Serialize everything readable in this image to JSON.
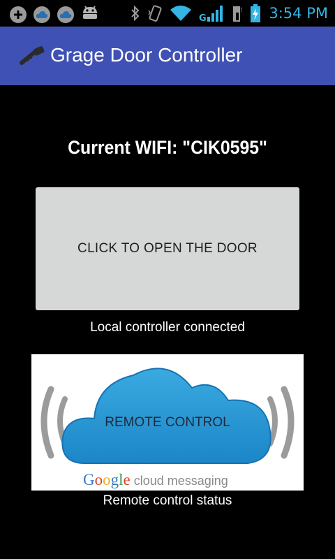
{
  "status_bar": {
    "time": "3:54 PM",
    "network_label": "G",
    "colors": {
      "accent": "#33b5e5",
      "icon_gray": "#9a9a9a"
    }
  },
  "app_bar": {
    "title": "Grage Door Controller",
    "background": "#3f51b5"
  },
  "main": {
    "wifi_text": "Current WIFI: \"CIK0595\"",
    "open_button_label": "CLICK TO OPEN THE DOOR",
    "local_status": "Local controller connected",
    "remote_button_label": "REMOTE CONTROL",
    "remote_logo": {
      "google": "Google",
      "product": "cloud messaging",
      "letters": [
        {
          "ch": "G",
          "color": "#3b7ac4"
        },
        {
          "ch": "o",
          "color": "#d8442f"
        },
        {
          "ch": "o",
          "color": "#e8b31c"
        },
        {
          "ch": "g",
          "color": "#3b7ac4"
        },
        {
          "ch": "l",
          "color": "#3b9a4a"
        },
        {
          "ch": "e",
          "color": "#d8442f"
        }
      ]
    },
    "remote_status": "Remote control status"
  }
}
